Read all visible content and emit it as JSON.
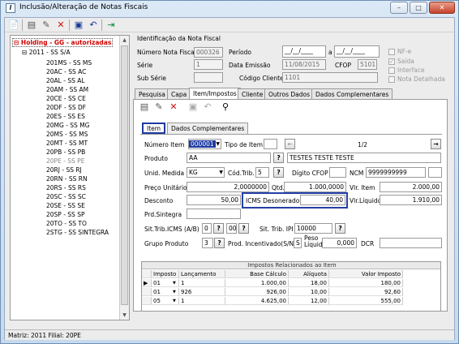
{
  "window": {
    "title": "Inclusão/Alteração de Notas Fiscais"
  },
  "tree": {
    "root": "Holding -  GG -  autorizadas",
    "group": "2011 - SS S/A",
    "items": [
      "201MS - SS MS",
      "20AC - SS AC",
      "20AL - SS AL",
      "20AM - SS AM",
      "20CE - SS CE",
      "20DF - SS DF",
      "20ES - SS ES",
      "20MG - SS MG",
      "20MS - SS MS",
      "20MT - SS MT",
      "20PB - SS PB",
      "20PE - SS PE",
      "20RJ - SS RJ",
      "20RN - SS RN",
      "20RS - SS RS",
      "20SC - SS SC",
      "20SE - SS SE",
      "20SP - SS SP",
      "20TO - SS TO",
      "2STG - SS SINTEGRA"
    ]
  },
  "ident": {
    "header": "Identificação da Nota Fiscal",
    "numero_label": "Número Nota Fiscal",
    "numero": "000326",
    "periodo_label": "Período",
    "periodo_de": "__/__/____",
    "periodo_a_label": "a",
    "periodo_ate": "__/__/____",
    "serie_label": "Série",
    "serie": "1",
    "data_emissao_label": "Data Emissão",
    "data_emissao": "11/08/2015",
    "cfop_label": "CFOP",
    "cfop": "5101",
    "subserie_label": "Sub Série",
    "subserie": "",
    "cliente_label": "Código Cliente",
    "cliente": "1101"
  },
  "flags": {
    "nfe": "NF-e",
    "saida": "Saída",
    "interface": "Interface",
    "detalhada": "Nota Detalhada"
  },
  "tabs": [
    "Pesquisa",
    "Capa",
    "Item/Impostos",
    "Cliente",
    "Outros Dados",
    "Dados Complementares"
  ],
  "subtabs": [
    "Item",
    "Dados Complementares"
  ],
  "item": {
    "numero_label": "Número Item",
    "numero": "000001",
    "tipo_label": "Tipo de Item",
    "tipo": "",
    "pagina": "1/2",
    "produto_label": "Produto",
    "produto": "AA",
    "produto_desc": "TESTES TESTE TESTE",
    "unid_label": "Unid. Medida",
    "unid": "KG",
    "codtrib_label": "Cód.Trib.",
    "codtrib": "5",
    "digito_label": "Dígito CFOP",
    "digito": "",
    "ncm_label": "NCM",
    "ncm": "9999999999",
    "ncm2": "",
    "preco_label": "Preço Unitário",
    "preco": "2,0000000",
    "qtd_label": "Qtd.",
    "qtd": "1.000,0000",
    "vlritem_label": "Vlr. Item",
    "vlritem": "2.000,00",
    "desconto_label": "Desconto",
    "desconto": "50,00",
    "icmsdes_label": "ICMS Desonerado",
    "icmsdes": "40,00",
    "vlrliq_label": "Vlr.Líquido",
    "vlrliq": "1.910,00",
    "prdsint_label": "Prd.Sintegra",
    "prdsint": "",
    "sittrib_label": "Sit.Trib.ICMS (A/B)",
    "sittrib_a": "0",
    "sittrib_b": "00",
    "sittribipi_label": "Sit. Trib. IPI",
    "sittribipi": "10000",
    "grupo_label": "Grupo Produto",
    "grupo": "3",
    "prodinc_label": "Prod. Incentivado(S/N)",
    "prodinc": "S",
    "peso_label": "Peso Líquido",
    "peso": "0,000",
    "dcr_label": "DCR",
    "dcr": ""
  },
  "impostos": {
    "title": "Impostos Relacionados ao Item",
    "columns": [
      "Imposto",
      "Lançamento",
      "Base Cálculo",
      "Alíquota",
      "Valor Imposto"
    ],
    "rows": [
      [
        "01",
        "1",
        "1.000,00",
        "18,00",
        "180,00"
      ],
      [
        "01",
        "926",
        "926,00",
        "10,00",
        "92,60"
      ],
      [
        "05",
        "1",
        "4.625,00",
        "12,00",
        "555,00"
      ]
    ]
  },
  "status": "Matriz: 2011 Filial: 20PE"
}
